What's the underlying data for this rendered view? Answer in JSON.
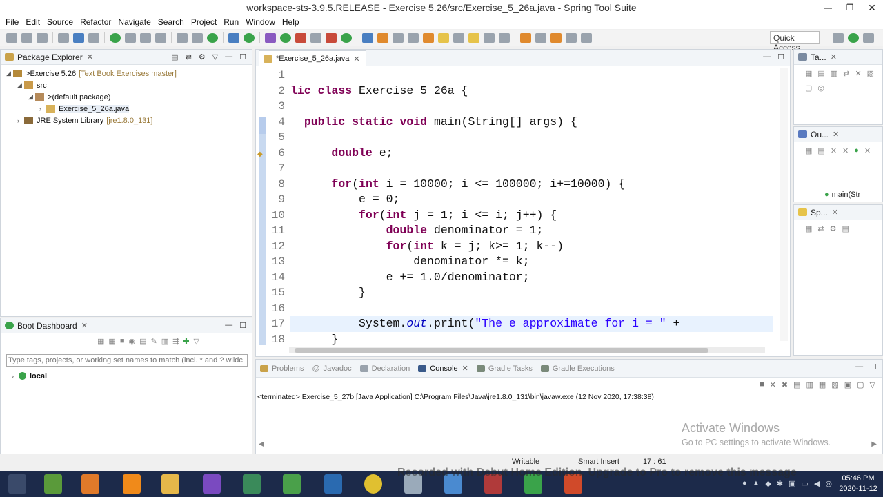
{
  "window": {
    "title": "workspace-sts-3.9.5.RELEASE - Exercise 5.26/src/Exercise_5_26a.java - Spring Tool Suite"
  },
  "menu": [
    "File",
    "Edit",
    "Source",
    "Refactor",
    "Navigate",
    "Search",
    "Project",
    "Run",
    "Window",
    "Help"
  ],
  "toolbar": {
    "quick_access": "Quick Access"
  },
  "package_explorer": {
    "tab": "Package Explorer",
    "tree": [
      {
        "label": "Exercise 5.26",
        "decoration": "[Text Book Exercises master]",
        "prefix": "> "
      },
      {
        "label": "src",
        "decoration": "",
        "prefix": ""
      },
      {
        "label": "(default package)",
        "decoration": "",
        "prefix": "> "
      },
      {
        "label": "Exercise_5_26a.java",
        "decoration": "",
        "prefix": ""
      },
      {
        "label": "JRE System Library",
        "decoration": "[jre1.8.0_131]",
        "prefix": ""
      }
    ]
  },
  "boot_dashboard": {
    "tab": "Boot Dashboard",
    "filter_placeholder": "Type tags, projects, or working set names to match (incl. * and ? wildc",
    "items": [
      {
        "label": "local"
      }
    ]
  },
  "editor": {
    "tab": "*Exercise_5_26a.java",
    "line_numbers": [
      "1",
      "2",
      "3",
      "4",
      "5",
      "6",
      "7",
      "8",
      "9",
      "10",
      "11",
      "12",
      "13",
      "14",
      "15",
      "16",
      "17",
      "18"
    ]
  },
  "right_panels": {
    "task_tab": "Ta...",
    "outline_tab": "Ou...",
    "outline_item": "main(Str",
    "spring_tab": "Sp..."
  },
  "console": {
    "tabs": [
      "Problems",
      "Javadoc",
      "Declaration",
      "Console",
      "Gradle Tasks",
      "Gradle Executions"
    ],
    "active_tab": "Console",
    "terminated": "<terminated> Exercise_5_27b [Java Application] C:\\Program Files\\Java\\jre1.8.0_131\\bin\\javaw.exe (12 Nov 2020, 17:38:38)"
  },
  "status": {
    "writable": "Writable",
    "insert_mode": "Smart Insert",
    "position": "17 : 61"
  },
  "overlay": {
    "activate_title": "Activate Windows",
    "activate_sub": "Go to PC settings to activate Windows.",
    "watermark": "Recorded with Debut Home Edition. Upgrade to Pro to remove this message"
  },
  "taskbar": {
    "time": "05:46 PM",
    "date": "2020-11-12"
  },
  "colors": {
    "keyword": "#7f0055",
    "string": "#2a00ff",
    "field": "#0000c0",
    "taskbar": "#1c2a4a"
  }
}
